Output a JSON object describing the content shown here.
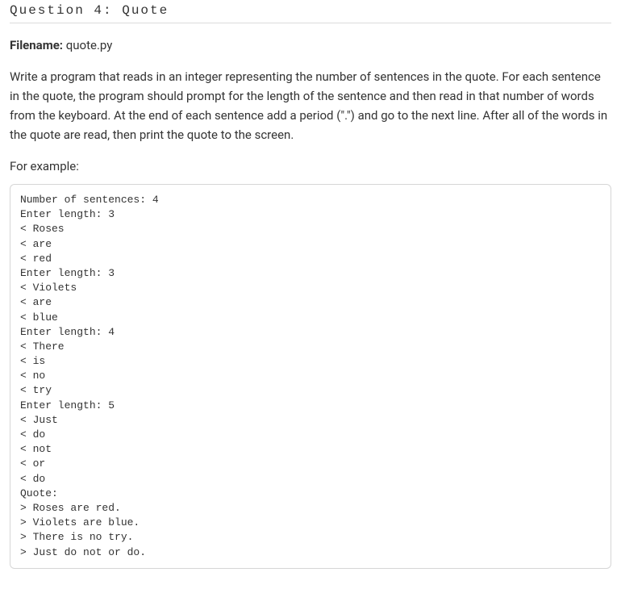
{
  "question": {
    "title": "Question 4: Quote",
    "filename_label": "Filename:",
    "filename_value": "quote.py",
    "description": "Write a program that reads in an integer representing the number of sentences in the quote. For each sentence in the quote, the program should prompt for the length of the sentence and then read in that number of words from the keyboard. At the end of each sentence add a period (\".\") and go to the next line. After all of the words in the quote are read, then print the quote to the screen.",
    "example_label": "For example:",
    "example_output": "Number of sentences: 4\nEnter length: 3\n< Roses\n< are\n< red\nEnter length: 3\n< Violets\n< are\n< blue\nEnter length: 4\n< There\n< is\n< no\n< try\nEnter length: 5\n< Just\n< do\n< not\n< or\n< do\nQuote:\n> Roses are red.\n> Violets are blue.\n> There is no try.\n> Just do not or do."
  }
}
